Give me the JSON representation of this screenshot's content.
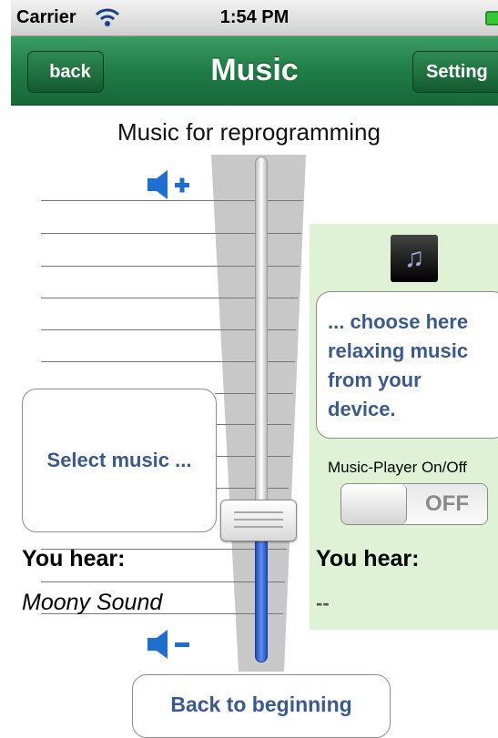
{
  "status_bar": {
    "carrier": "Carrier",
    "time": "1:54 PM"
  },
  "nav": {
    "title": "Music",
    "back_label": "back",
    "settings_label": "Setting"
  },
  "heading": "Music for reprogramming",
  "icons": {
    "volume_up": "volume-up-icon",
    "volume_down": "volume-down-icon",
    "music_note": "music-note-icon",
    "wifi": "wifi-icon",
    "battery": "battery-icon"
  },
  "left": {
    "select_label": "Select music ...",
    "you_hear_label": "You hear:",
    "current_sound": "Moony Sound"
  },
  "volume": {
    "level": 0.32
  },
  "right": {
    "choose_lines": [
      "... choose here",
      "relaxing music",
      "from your",
      "device."
    ],
    "player_label": "Music-Player On/Off",
    "player_state": "OFF",
    "you_hear_label": "You hear:",
    "current_value": "--"
  },
  "footer": {
    "back_to_beginning": "Back to beginning"
  },
  "colors": {
    "nav_green": "#1f7c45",
    "panel_green": "#e0f2d5",
    "link_blue": "#3a5a8c",
    "slider_blue": "#3b6fe0"
  }
}
